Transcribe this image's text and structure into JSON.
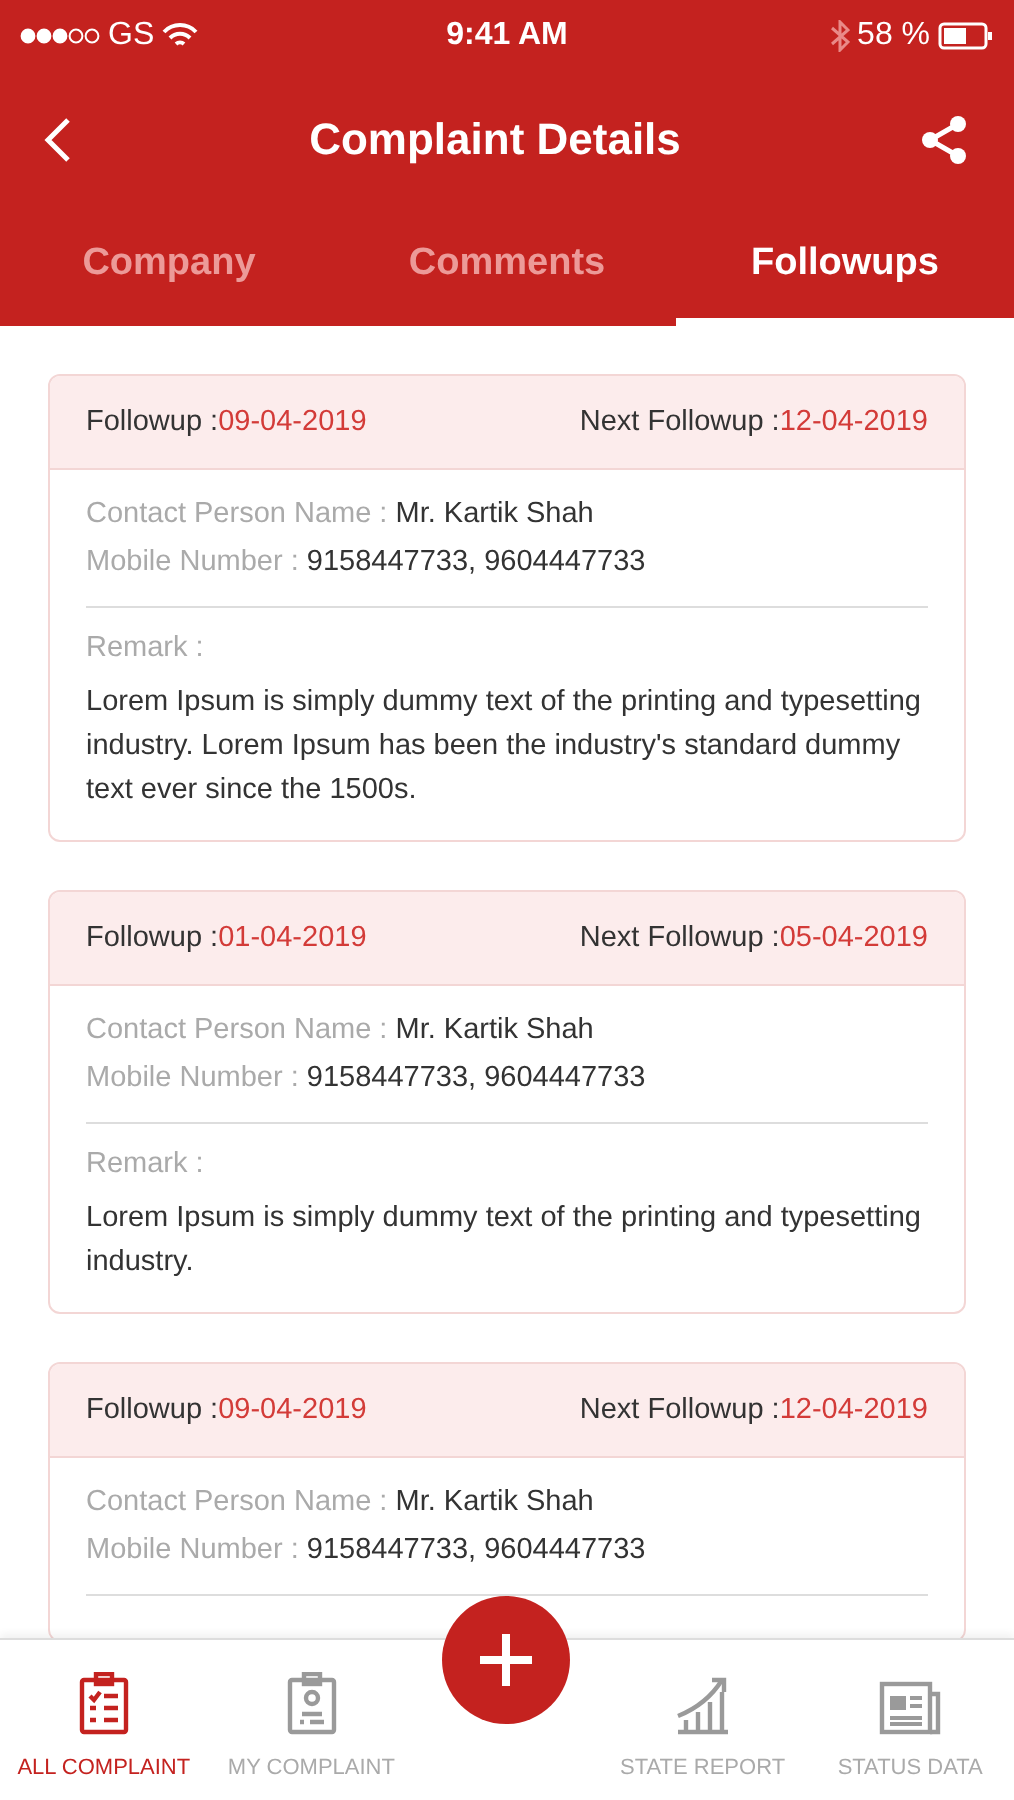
{
  "status_bar": {
    "carrier": "GS",
    "time": "9:41 AM",
    "battery": "58 %"
  },
  "header": {
    "title": "Complaint Details"
  },
  "tabs": [
    {
      "label": "Company",
      "selected": false
    },
    {
      "label": "Comments",
      "selected": false
    },
    {
      "label": "Followups",
      "selected": true
    }
  ],
  "followups": [
    {
      "date_label": "Followup :",
      "date": "09-04-2019",
      "next_label": "Next Followup :",
      "next_date": "12-04-2019",
      "fields": [
        {
          "label": "Contact Person Name :",
          "value": "Mr. Kartik Shah"
        },
        {
          "label": "Mobile Number :",
          "value": "9158447733, 9604447733"
        }
      ],
      "remark_label": "Remark :",
      "remark": "Lorem Ipsum is simply dummy text of the printing and typesetting industry. Lorem Ipsum has been the industry's standard dummy text ever since the 1500s."
    },
    {
      "date_label": "Followup :",
      "date": "01-04-2019",
      "next_label": "Next Followup :",
      "next_date": "05-04-2019",
      "fields": [
        {
          "label": "Contact Person Name :",
          "value": "Mr. Kartik Shah"
        },
        {
          "label": "Mobile Number :",
          "value": "9158447733, 9604447733"
        }
      ],
      "remark_label": "Remark :",
      "remark": "Lorem Ipsum is simply dummy text of the printing and typesetting industry."
    },
    {
      "date_label": "Followup :",
      "date": "09-04-2019",
      "next_label": "Next Followup :",
      "next_date": "12-04-2019",
      "fields": [
        {
          "label": "Contact Person Name :",
          "value": "Mr. Kartik Shah"
        },
        {
          "label": "Mobile Number :",
          "value": "9158447733, 9604447733"
        }
      ]
    }
  ],
  "bottom_nav": [
    {
      "label": "ALL COMPLAINT",
      "kind": "checklist",
      "selected": true
    },
    {
      "label": "MY COMPLAINT",
      "kind": "badge",
      "selected": false
    },
    {
      "kind": "add"
    },
    {
      "label": "STATE REPORT",
      "kind": "growth",
      "selected": false
    },
    {
      "label": "STATUS DATA",
      "kind": "news",
      "selected": false
    }
  ]
}
